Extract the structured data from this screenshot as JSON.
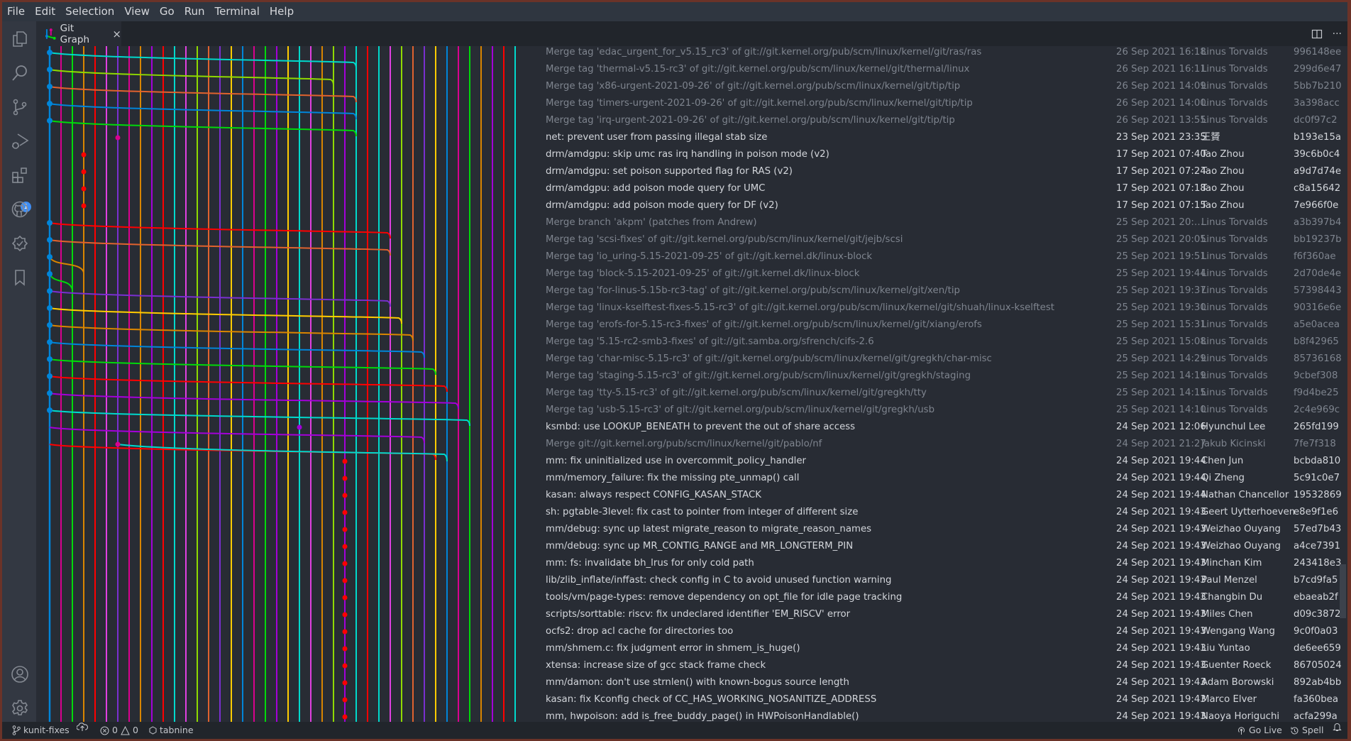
{
  "menu": [
    "File",
    "Edit",
    "Selection",
    "View",
    "Go",
    "Run",
    "Terminal",
    "Help"
  ],
  "activity_bar": {
    "items": [
      "explorer-icon",
      "search-icon",
      "source-control-icon",
      "run-debug-icon",
      "extensions-icon",
      "github-icon",
      "gitlens-icon",
      "bookmarks-icon"
    ],
    "extensions_badge": "1",
    "bottom": [
      "account-icon",
      "settings-gear-icon"
    ]
  },
  "tab": {
    "label": "Git Graph",
    "close": "×"
  },
  "tab_actions": {
    "split": "split-editor-icon",
    "more": "···"
  },
  "graph": {
    "lane_colors": [
      "#0085d9",
      "#d9008f",
      "#00d90a",
      "#d98500",
      "#ff0000",
      "#e040e0",
      "#7a2fd0",
      "#d9008f",
      "#d98500",
      "#a300d9",
      "#ff0000",
      "#00d9cc",
      "#e040e0",
      "#8fd900",
      "#e0622e",
      "#7a2fd0",
      "#ffcc00",
      "#0085d9",
      "#d9008f",
      "#00d90a",
      "#a300d9",
      "#ffcc00",
      "#00d9cc",
      "#e040e0",
      "#d98500",
      "#8fd900",
      "#a300d9",
      "#00d9cc",
      "#ff0000",
      "#00d9cc",
      "#e040e0",
      "#8fd900",
      "#e0622e",
      "#7a2fd0",
      "#ffcc00",
      "#0085d9",
      "#d9008f",
      "#00d90a",
      "#d98500",
      "#a300d9",
      "#ff0000",
      "#00d9cc",
      "#e040e0",
      "#8fd900"
    ]
  },
  "commits": [
    {
      "message": "Merge tag 'edac_urgent_for_v5.15_rc3' of git://git.kernel.org/pub/scm/linux/kernel/git/ras/ras",
      "date": "26 Sep 2021 16:18",
      "author": "Linus Torvalds",
      "hash": "996148ee",
      "merge": true
    },
    {
      "message": "Merge tag 'thermal-v5.15-rc3' of git://git.kernel.org/pub/scm/linux/kernel/git/thermal/linux",
      "date": "26 Sep 2021 16:11",
      "author": "Linus Torvalds",
      "hash": "299d6e47",
      "merge": true
    },
    {
      "message": "Merge tag 'x86-urgent-2021-09-26' of git://git.kernel.org/pub/scm/linux/kernel/git/tip/tip",
      "date": "26 Sep 2021 14:09",
      "author": "Linus Torvalds",
      "hash": "5bb7b210",
      "merge": true
    },
    {
      "message": "Merge tag 'timers-urgent-2021-09-26' of git://git.kernel.org/pub/scm/linux/kernel/git/tip/tip",
      "date": "26 Sep 2021 14:00",
      "author": "Linus Torvalds",
      "hash": "3a398acc",
      "merge": true
    },
    {
      "message": "Merge tag 'irq-urgent-2021-09-26' of git://git.kernel.org/pub/scm/linux/kernel/git/tip/tip",
      "date": "26 Sep 2021 13:55",
      "author": "Linus Torvalds",
      "hash": "dc0f97c2",
      "merge": true
    },
    {
      "message": "net: prevent user from passing illegal stab size",
      "date": "23 Sep 2021 23:35",
      "author": "王贇",
      "hash": "b193e15a",
      "merge": false
    },
    {
      "message": "drm/amdgpu: skip umc ras irq handling in poison mode (v2)",
      "date": "17 Sep 2021 07:40",
      "author": "Tao Zhou",
      "hash": "39c6b0c4",
      "merge": false
    },
    {
      "message": "drm/amdgpu: set poison supported flag for RAS (v2)",
      "date": "17 Sep 2021 07:24",
      "author": "Tao Zhou",
      "hash": "a9d7d74e",
      "merge": false
    },
    {
      "message": "drm/amdgpu: add poison mode query for UMC",
      "date": "17 Sep 2021 07:18",
      "author": "Tao Zhou",
      "hash": "c8a15642",
      "merge": false
    },
    {
      "message": "drm/amdgpu: add poison mode query for DF (v2)",
      "date": "17 Sep 2021 07:15",
      "author": "Tao Zhou",
      "hash": "7e966f0e",
      "merge": false
    },
    {
      "message": "Merge branch 'akpm' (patches from Andrew)",
      "date": "25 Sep 2021 20:…",
      "author": "Linus Torvalds",
      "hash": "a3b397b4",
      "merge": true
    },
    {
      "message": "Merge tag 'scsi-fixes' of git://git.kernel.org/pub/scm/linux/kernel/git/jejb/scsi",
      "date": "25 Sep 2021 20:05",
      "author": "Linus Torvalds",
      "hash": "bb19237b",
      "merge": true
    },
    {
      "message": "Merge tag 'io_uring-5.15-2021-09-25' of git://git.kernel.dk/linux-block",
      "date": "25 Sep 2021 19:51",
      "author": "Linus Torvalds",
      "hash": "f6f360ae",
      "merge": true
    },
    {
      "message": "Merge tag 'block-5.15-2021-09-25' of git://git.kernel.dk/linux-block",
      "date": "25 Sep 2021 19:44",
      "author": "Linus Torvalds",
      "hash": "2d70de4e",
      "merge": true
    },
    {
      "message": "Merge tag 'for-linus-5.15b-rc3-tag' of git://git.kernel.org/pub/scm/linux/kernel/git/xen/tip",
      "date": "25 Sep 2021 19:37",
      "author": "Linus Torvalds",
      "hash": "57398443",
      "merge": true
    },
    {
      "message": "Merge tag 'linux-kselftest-fixes-5.15-rc3' of git://git.kernel.org/pub/scm/linux/kernel/git/shuah/linux-kselftest",
      "date": "25 Sep 2021 19:30",
      "author": "Linus Torvalds",
      "hash": "90316e6e",
      "merge": true
    },
    {
      "message": "Merge tag 'erofs-for-5.15-rc3-fixes' of git://git.kernel.org/pub/scm/linux/kernel/git/xiang/erofs",
      "date": "25 Sep 2021 15:31",
      "author": "Linus Torvalds",
      "hash": "a5e0acea",
      "merge": true
    },
    {
      "message": "Merge tag '5.15-rc2-smb3-fixes' of git://git.samba.org/sfrench/cifs-2.6",
      "date": "25 Sep 2021 15:08",
      "author": "Linus Torvalds",
      "hash": "b8f42965",
      "merge": true
    },
    {
      "message": "Merge tag 'char-misc-5.15-rc3' of git://git.kernel.org/pub/scm/linux/kernel/git/gregkh/char-misc",
      "date": "25 Sep 2021 14:29",
      "author": "Linus Torvalds",
      "hash": "85736168",
      "merge": true
    },
    {
      "message": "Merge tag 'staging-5.15-rc3' of git://git.kernel.org/pub/scm/linux/kernel/git/gregkh/staging",
      "date": "25 Sep 2021 14:19",
      "author": "Linus Torvalds",
      "hash": "9cbef308",
      "merge": true
    },
    {
      "message": "Merge tag 'tty-5.15-rc3' of git://git.kernel.org/pub/scm/linux/kernel/git/gregkh/tty",
      "date": "25 Sep 2021 14:15",
      "author": "Linus Torvalds",
      "hash": "f9d4be25",
      "merge": true
    },
    {
      "message": "Merge tag 'usb-5.15-rc3' of git://git.kernel.org/pub/scm/linux/kernel/git/gregkh/usb",
      "date": "25 Sep 2021 14:10",
      "author": "Linus Torvalds",
      "hash": "2c4e969c",
      "merge": true
    },
    {
      "message": "ksmbd: use LOOKUP_BENEATH to prevent the out of share access",
      "date": "24 Sep 2021 12:06",
      "author": "Hyunchul Lee",
      "hash": "265fd199",
      "merge": false
    },
    {
      "message": "Merge git://git.kernel.org/pub/scm/linux/kernel/git/pablo/nf",
      "date": "24 Sep 2021 21:27",
      "author": "Jakub Kicinski",
      "hash": "7fe7f318",
      "merge": true
    },
    {
      "message": "mm: fix uninitialized use in overcommit_policy_handler",
      "date": "24 Sep 2021 19:44",
      "author": "Chen Jun",
      "hash": "bcbda810",
      "merge": false
    },
    {
      "message": "mm/memory_failure: fix the missing pte_unmap() call",
      "date": "24 Sep 2021 19:44",
      "author": "Qi Zheng",
      "hash": "5c91c0e7",
      "merge": false
    },
    {
      "message": "kasan: always respect CONFIG_KASAN_STACK",
      "date": "24 Sep 2021 19:44",
      "author": "Nathan Chancellor",
      "hash": "19532869",
      "merge": false
    },
    {
      "message": "sh: pgtable-3level: fix cast to pointer from integer of different size",
      "date": "24 Sep 2021 19:43",
      "author": "Geert Uytterhoeven",
      "hash": "e8e9f1e6",
      "merge": false
    },
    {
      "message": "mm/debug: sync up latest migrate_reason to migrate_reason_names",
      "date": "24 Sep 2021 19:43",
      "author": "Weizhao Ouyang",
      "hash": "57ed7b43",
      "merge": false
    },
    {
      "message": "mm/debug: sync up MR_CONTIG_RANGE and MR_LONGTERM_PIN",
      "date": "24 Sep 2021 19:43",
      "author": "Weizhao Ouyang",
      "hash": "a4ce7391",
      "merge": false
    },
    {
      "message": "mm: fs: invalidate bh_lrus for only cold path",
      "date": "24 Sep 2021 19:43",
      "author": "Minchan Kim",
      "hash": "243418e3",
      "merge": false
    },
    {
      "message": "lib/zlib_inflate/inffast: check config in C to avoid unused function warning",
      "date": "24 Sep 2021 19:43",
      "author": "Paul Menzel",
      "hash": "b7cd9fa5",
      "merge": false
    },
    {
      "message": "tools/vm/page-types: remove dependency on opt_file for idle page tracking",
      "date": "24 Sep 2021 19:43",
      "author": "Changbin Du",
      "hash": "ebaeab2f",
      "merge": false
    },
    {
      "message": "scripts/sorttable: riscv: fix undeclared identifier 'EM_RISCV' error",
      "date": "24 Sep 2021 19:43",
      "author": "Miles Chen",
      "hash": "d09c3872",
      "merge": false
    },
    {
      "message": "ocfs2: drop acl cache for directories too",
      "date": "24 Sep 2021 19:43",
      "author": "Wengang Wang",
      "hash": "9c0f0a03",
      "merge": false
    },
    {
      "message": "mm/shmem.c: fix judgment error in shmem_is_huge()",
      "date": "24 Sep 2021 19:43",
      "author": "Liu Yuntao",
      "hash": "de6ee659",
      "merge": false
    },
    {
      "message": "xtensa: increase size of gcc stack frame check",
      "date": "24 Sep 2021 19:43",
      "author": "Guenter Roeck",
      "hash": "86705024",
      "merge": false
    },
    {
      "message": "mm/damon: don't use strnlen() with known-bogus source length",
      "date": "24 Sep 2021 19:43",
      "author": "Adam Borowski",
      "hash": "892ab4bb",
      "merge": false
    },
    {
      "message": "kasan: fix Kconfig check of CC_HAS_WORKING_NOSANITIZE_ADDRESS",
      "date": "24 Sep 2021 19:43",
      "author": "Marco Elver",
      "hash": "fa360bea",
      "merge": false
    },
    {
      "message": "mm, hwpoison: add is_free_buddy_page() in HWPoisonHandlable()",
      "date": "24 Sep 2021 19:43",
      "author": "Naoya Horiguchi",
      "hash": "acfa299a",
      "merge": false
    }
  ],
  "statusbar": {
    "branch": "kunit-fixes",
    "errors": "0",
    "warnings": "0",
    "tabnine": "tabnine",
    "go_live": "Go Live",
    "spell": "Spell"
  }
}
